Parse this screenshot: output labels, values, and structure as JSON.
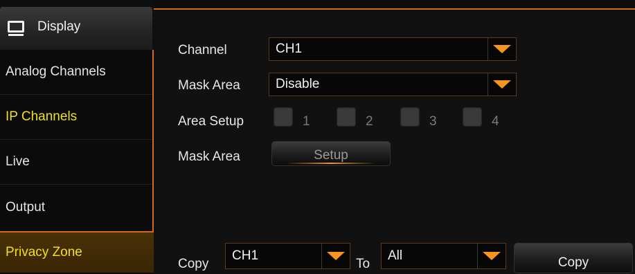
{
  "sidebar": {
    "header_label": "Display",
    "header_icon": "monitor-icon",
    "items": [
      {
        "label": "Analog Channels",
        "active": false
      },
      {
        "label": "IP Channels",
        "active": false,
        "highlight": true
      },
      {
        "label": "Live",
        "active": false
      },
      {
        "label": "Output",
        "active": false
      }
    ],
    "selected_label": "Privacy Zone"
  },
  "form": {
    "channel_label": "Channel",
    "channel_value": "CH1",
    "mask_area_label": "Mask Area",
    "mask_area_value": "Disable",
    "area_setup_label": "Area Setup",
    "areas": [
      "1",
      "2",
      "3",
      "4"
    ],
    "mask_area_setup_label": "Mask Area",
    "setup_button": "Setup"
  },
  "copy_bar": {
    "copy_label": "Copy",
    "from_value": "CH1",
    "to_label": "To",
    "to_value": "All",
    "copy_button": "Copy"
  },
  "colors": {
    "accent": "#d2691e",
    "arrow": "#f7941d",
    "highlight_text": "#f0e022"
  }
}
